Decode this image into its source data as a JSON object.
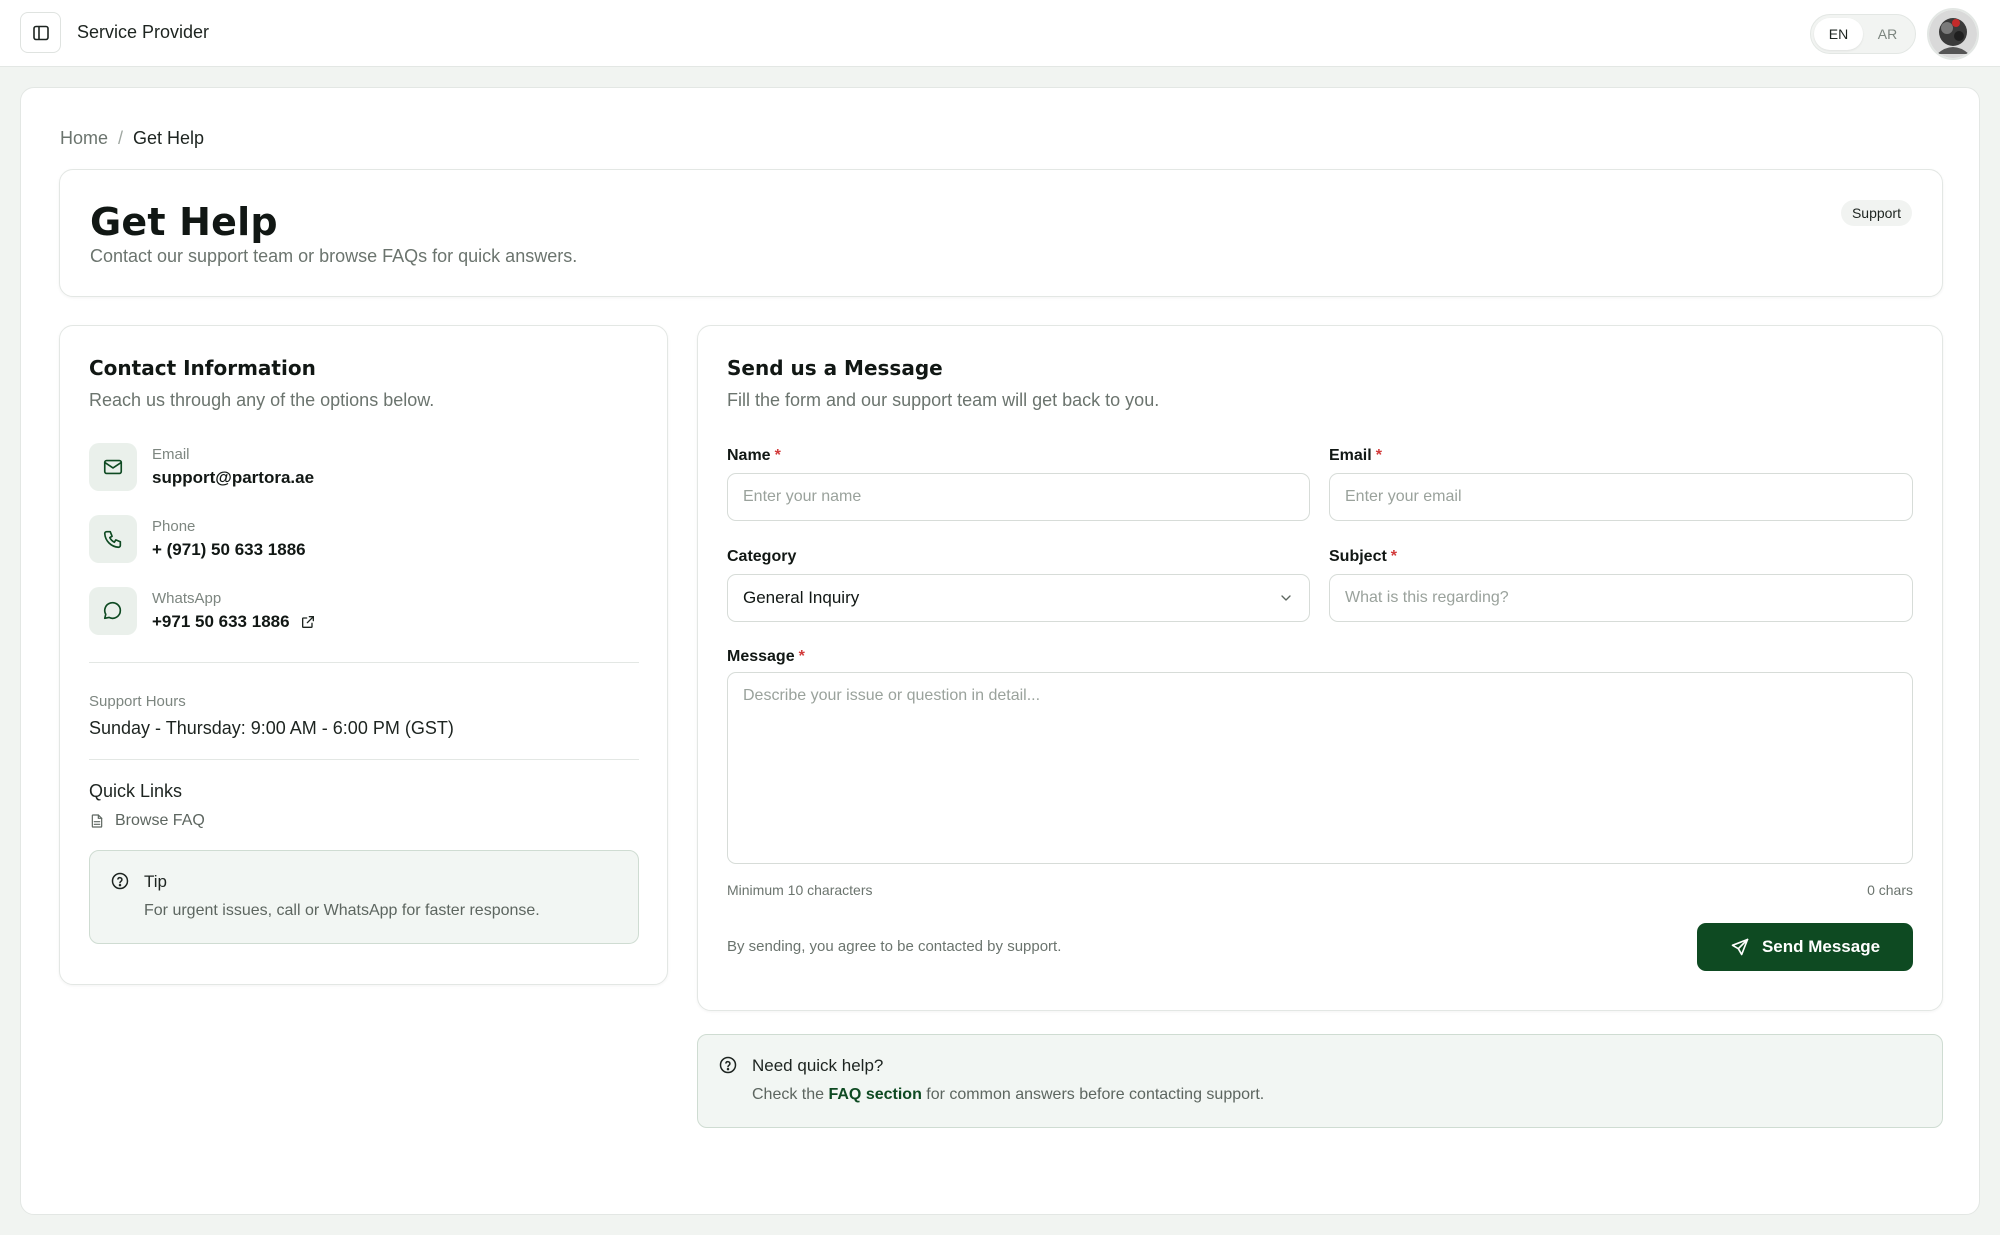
{
  "header": {
    "app_title": "Service Provider",
    "lang_options": [
      "EN",
      "AR"
    ],
    "active_lang": "EN"
  },
  "breadcrumb": {
    "home": "Home",
    "separator": "/",
    "current": "Get Help"
  },
  "page": {
    "title": "Get Help",
    "subtitle": "Contact our support team or browse FAQs for quick answers.",
    "badge": "Support"
  },
  "contact": {
    "title": "Contact Information",
    "subtitle": "Reach us through any of the options below.",
    "items": [
      {
        "label": "Email",
        "value": "support@partora.ae",
        "icon": "mail-icon"
      },
      {
        "label": "Phone",
        "value": "+ (971) 50 633 1886",
        "icon": "phone-icon"
      },
      {
        "label": "WhatsApp",
        "value": "+971 50 633 1886",
        "icon": "message-circle-icon"
      }
    ],
    "hours_label": "Support Hours",
    "hours_value": "Sunday - Thursday: 9:00 AM - 6:00 PM (GST)",
    "quick_links_title": "Quick Links",
    "quick_links": [
      "Browse FAQ"
    ],
    "tip_title": "Tip",
    "tip_text": "For urgent issues, call or WhatsApp for faster response."
  },
  "form": {
    "title": "Send us a Message",
    "subtitle": "Fill the form and our support team will get back to you.",
    "name_label": "Name",
    "name_placeholder": "Enter your name",
    "name_value": "",
    "email_label": "Email",
    "email_placeholder": "Enter your email",
    "email_value": "",
    "category_label": "Category",
    "category_value": "General Inquiry",
    "subject_label": "Subject",
    "subject_placeholder": "What is this regarding?",
    "subject_value": "",
    "message_label": "Message",
    "message_placeholder": "Describe your issue or question in detail...",
    "message_value": "",
    "required_mark": "*",
    "min_hint": "Minimum 10 characters",
    "char_count": "0 chars",
    "consent": "By sending, you agree to be contacted by support.",
    "send_label": "Send Message"
  },
  "quick_help": {
    "title": "Need quick help?",
    "text_before": "Check the ",
    "link": "FAQ section",
    "text_after": " for common answers before contacting support."
  },
  "colors": {
    "accent": "#0e4a22",
    "required": "#d23b3b",
    "tip_bg": "#f2f6f3"
  }
}
